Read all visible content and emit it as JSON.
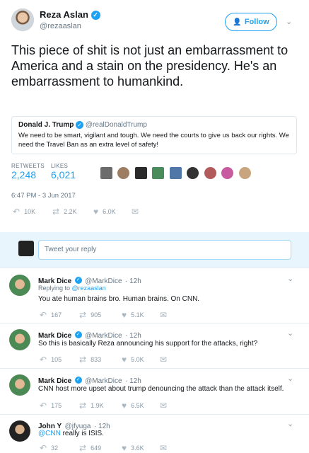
{
  "main_tweet": {
    "name": "Reza Aslan",
    "handle": "@rezaaslan",
    "follow_label": "Follow",
    "text": "This piece of shit is not just an embarrassment to America and a stain on the presidency. He's an embarrassment to humankind.",
    "quoted": {
      "name": "Donald J. Trump",
      "handle": "@realDonaldTrump",
      "text": "We need to be smart, vigilant and tough. We need the courts to give us back our rights. We need the Travel Ban as an extra level of safety!"
    },
    "stats": {
      "retweets_label": "RETWEETS",
      "retweets_value": "2,248",
      "likes_label": "LIKES",
      "likes_value": "6,021"
    },
    "timestamp": "6:47 PM - 3 Jun 2017",
    "actions": {
      "replies": "10K",
      "retweets": "2.2K",
      "likes": "6.0K"
    }
  },
  "reply_box": {
    "placeholder": "Tweet your reply"
  },
  "replies": [
    {
      "name": "Mark Dice",
      "handle": "@MarkDice",
      "time": "· 12h",
      "replying_label": "Replying to",
      "replying_to": "@rezaaslan",
      "text": "You ate human brains bro.  Human brains. On CNN.",
      "replies": "167",
      "retweets": "905",
      "likes": "5.1K"
    },
    {
      "name": "Mark Dice",
      "handle": "@MarkDice",
      "time": "· 12h",
      "text": "So this is basically Reza announcing his support for the attacks, right?",
      "replies": "105",
      "retweets": "833",
      "likes": "5.0K"
    },
    {
      "name": "Mark Dice",
      "handle": "@MarkDice",
      "time": "· 12h",
      "text": "CNN host more upset about trump denouncing the attack than the attack itself.",
      "replies": "175",
      "retweets": "1.9K",
      "likes": "6.5K"
    },
    {
      "name": "John Y",
      "handle": "@jfyuga",
      "time": "· 12h",
      "mention": "@CNN",
      "text": " really is ISIS.",
      "replies": "32",
      "retweets": "649",
      "likes": "3.6K"
    }
  ],
  "colors": {
    "accent": "#1da1f2",
    "muted": "#657786",
    "border": "#e6ecf0"
  },
  "icons": [
    "verified-badge",
    "chevron-down-icon",
    "reply-icon",
    "retweet-icon",
    "like-icon",
    "message-icon",
    "follow-person-icon"
  ]
}
